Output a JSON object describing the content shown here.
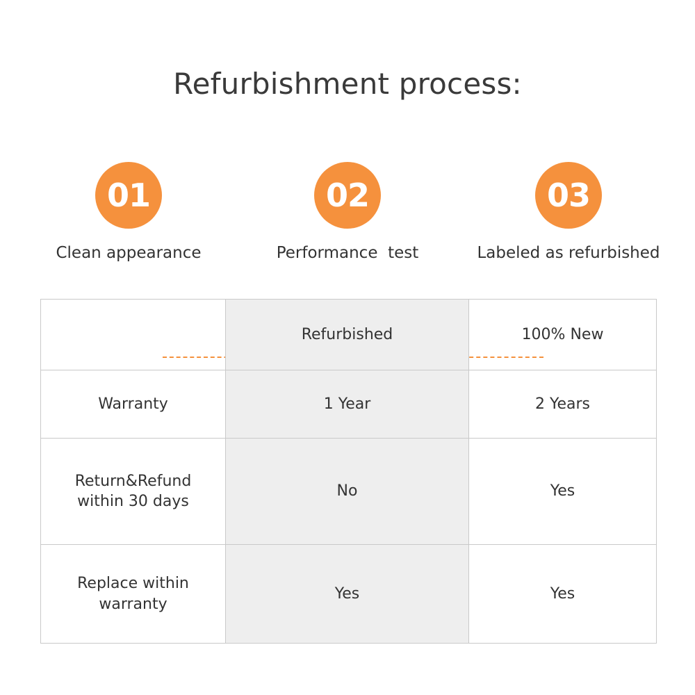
{
  "page": {
    "title": "Refurbishment process:",
    "accent_color": "#F5913D",
    "text_color": "#333333",
    "shaded_column_color": "#EEEEEE",
    "border_color": "#C9C9C9",
    "background_color": "#FFFFFF"
  },
  "steps": [
    {
      "number": "01",
      "label": "Clean appearance"
    },
    {
      "number": "02",
      "label": "Performance  test"
    },
    {
      "number": "03",
      "label": "Labeled as refurbished"
    }
  ],
  "table": {
    "header": {
      "label": "",
      "refurbished": "Refurbished",
      "new": "100% New"
    },
    "rows": [
      {
        "label": "Warranty",
        "refurbished": "1 Year",
        "new": "2 Years"
      },
      {
        "label": "Return&Refund\nwithin 30 days",
        "refurbished": "No",
        "new": "Yes"
      },
      {
        "label": "Replace within\nwarranty",
        "refurbished": "Yes",
        "new": "Yes"
      }
    ]
  }
}
